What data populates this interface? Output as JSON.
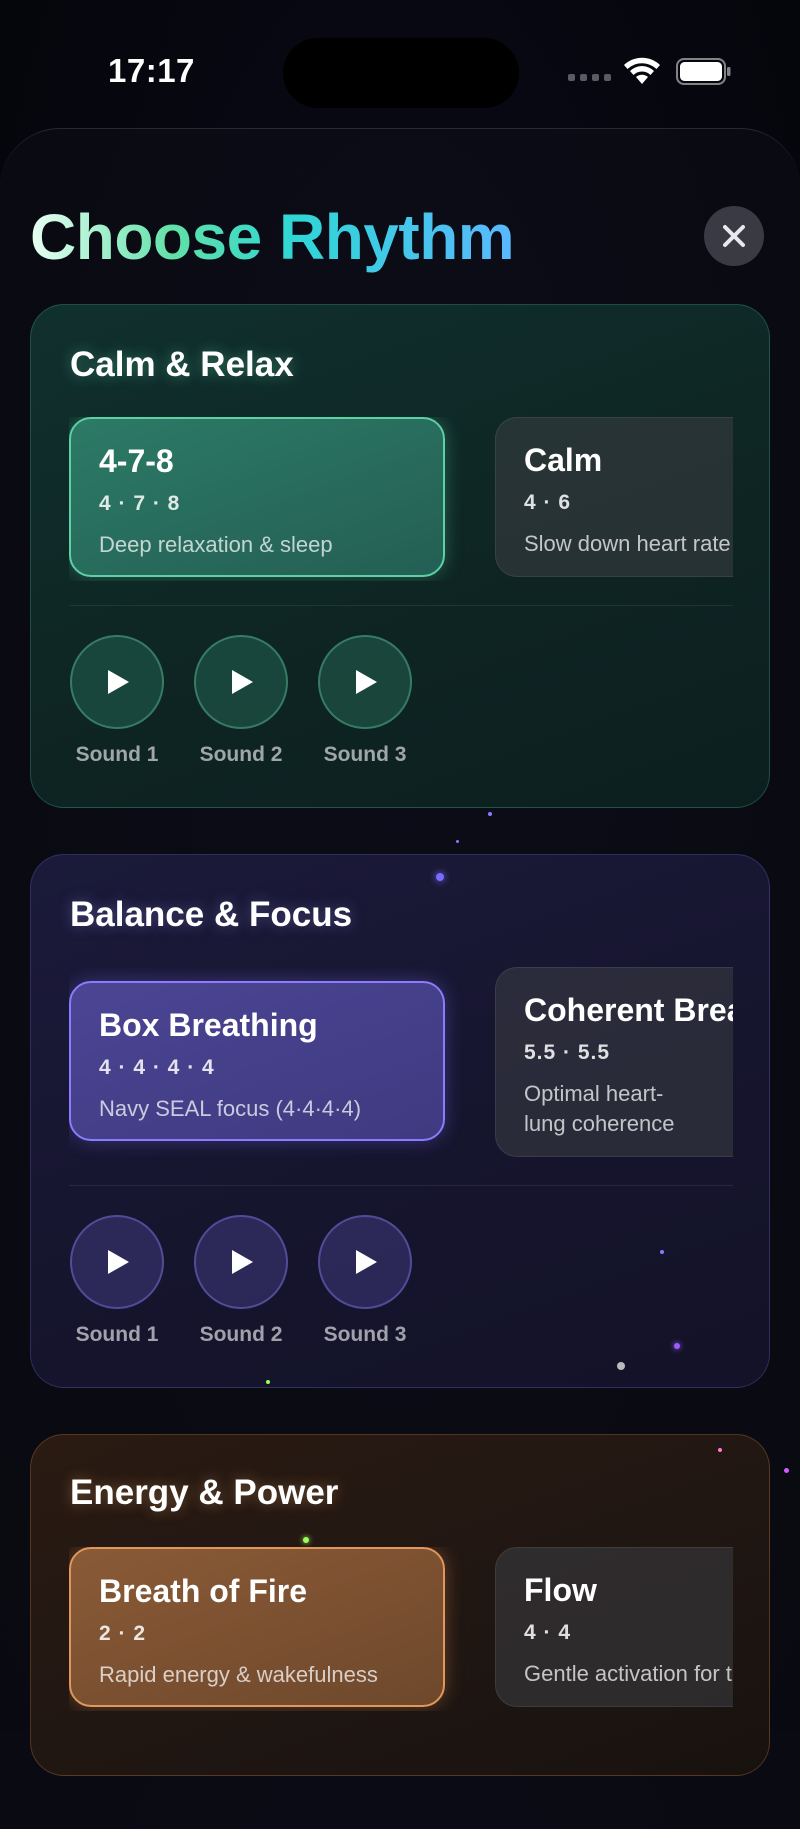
{
  "status_bar": {
    "time": "17:17"
  },
  "header": {
    "title": "Choose Rhythm"
  },
  "sections": [
    {
      "title": "Calm & Relax",
      "cards": [
        {
          "name": "4-7-8",
          "pattern": "4 · 7 · 8",
          "description": "Deep relaxation & sleep"
        },
        {
          "name": "Calm",
          "pattern": "4 · 6",
          "description": "Slow down heart rate"
        }
      ],
      "sounds": [
        "Sound 1",
        "Sound 2",
        "Sound 3"
      ]
    },
    {
      "title": "Balance & Focus",
      "cards": [
        {
          "name": "Box Breathing",
          "pattern": "4 · 4 · 4 · 4",
          "description": "Navy SEAL focus (4·4·4·4)"
        },
        {
          "name": "Coherent Breathing",
          "pattern": "5.5 · 5.5",
          "description": "Optimal heart-lung coherence"
        }
      ],
      "sounds": [
        "Sound 1",
        "Sound 2",
        "Sound 3"
      ]
    },
    {
      "title": "Energy & Power",
      "cards": [
        {
          "name": "Breath of Fire",
          "pattern": "2 · 2",
          "description": "Rapid energy & wakefulness"
        },
        {
          "name": "Flow",
          "pattern": "4 · 4",
          "description": "Gentle activation for the day"
        }
      ]
    }
  ],
  "colors": {
    "calm_accent": "#5cd1a6",
    "balance_accent": "#8b7bff",
    "energy_accent": "#e2965a"
  }
}
